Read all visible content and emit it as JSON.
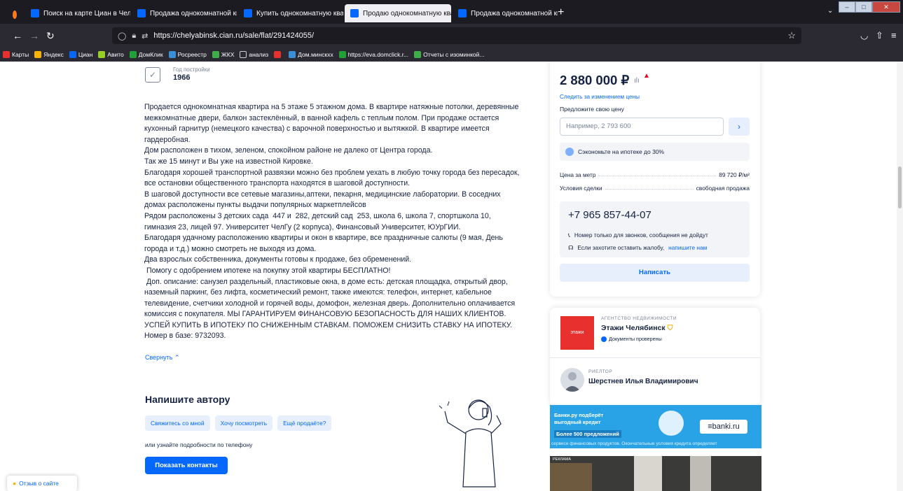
{
  "browser": {
    "tabs": [
      {
        "label": "Поиск на карте Циан в Челяб",
        "active": false
      },
      {
        "label": "Продажа однокомнатной ква",
        "active": false
      },
      {
        "label": "Купить однокомнатную кварт",
        "active": false
      },
      {
        "label": "Продаю однокомнатную квар",
        "active": true
      },
      {
        "label": "Продажа однокомнатной ква",
        "active": false
      }
    ],
    "new_tab": "+",
    "url": "https://chelyabinsk.cian.ru/sale/flat/291424055/",
    "bookmarks": [
      {
        "label": "Карты",
        "color": "#e8312e"
      },
      {
        "label": "Яндекс",
        "color": "#f6b400"
      },
      {
        "label": "Циан",
        "color": "#0468ff"
      },
      {
        "label": "Авито",
        "color": "#97cf26"
      },
      {
        "label": "ДомКлик",
        "color": "#21a038"
      },
      {
        "label": "Росреестр",
        "color": "#3a8fd8"
      },
      {
        "label": "ЖКХ",
        "color": "#3fae49"
      },
      {
        "label": "анализ",
        "color": "#cfcfd8"
      },
      {
        "label": "",
        "color": "#e8312e"
      },
      {
        "label": "Дом.минскхх",
        "color": "#3a8fd8"
      },
      {
        "label": "https://eva.domclick.r...",
        "color": "#21a038"
      },
      {
        "label": "Отчеты с изоминкой...",
        "color": "#3fae49"
      }
    ]
  },
  "listing": {
    "year_label": "Год постройки",
    "year_value": "1966",
    "description": [
      "Продается однокомнатная квартира на 5 этаже 5 этажном дома. В квартире натяжные потолки, деревянные межкомнатные двери, балкон застеклённый, в ванной кафель с теплым полом. При продаже остается кухонный гарнитур (немецкого качества) с варочной поверхностью и вытяжкой. В квартире имеется гардеробная.",
      "Дом расположен в тихом, зеленом, спокойном районе не далеко от Центра города.",
      "Так же 15 минут и Вы уже на известной Кировке.",
      "Благодаря хорошей транспортной развязки можно без проблем уехать в любую точку города без пересадок, все остановки общественного транспорта находятся в шаговой доступности.",
      "В шаговой доступности все сетевые магазины,аптеки, пекарня, медицинские лаборатории. В соседних домах расположены пункты выдачи популярных маркетплейсов",
      "Рядом расположены 3 детских сада  447 и  282, детский сад  253, школа 6, школа 7, спортшкола 10, гимназия 23, лицей 97. Университет ЧелГу (2 корпуса), Финансовый Университет, ЮУрГИИ.",
      "Благодаря удачному расположению квартиры и окон в квартире, все праздничные салюты (9 мая, День города и т.д.) можно смотреть не выходя из дома.",
      "Два взрослых собственника, документы готовы к продаже, без обременений.",
      " Помогу с одобрением ипотеке на покупку этой квартиры БЕСПЛАТНО!",
      " Доп. описание: санузел раздельный, пластиковые окна, в доме есть: детская площадка, открытый двор, наземный паркинг, без лифта, косметический ремонт, также имеются: телефон, интернет, кабельное телевидение, счетчики холодной и горячей воды, домофон, железная дверь. Дополнительно оплачивается комиссия с покупателя. МЫ ГАРАНТИРУЕМ ФИНАНСОВУЮ БЕЗОПАСНОСТЬ ДЛЯ НАШИХ КЛИЕНТОВ. УСПЕЙ КУПИТЬ В ИПОТЕКУ ПО СНИЖЕННЫМ СТАВКАМ. ПОМОЖЕМ СНИЗИТЬ СТАВКУ НА ИПОТЕКУ. Номер в базе: 9732093."
    ],
    "collapse_label": "Свернуть",
    "write_author": {
      "title": "Напишите автору",
      "chips": [
        "Свяжитесь со мной",
        "Хочу посмотреть",
        "Ещё продаёте?"
      ],
      "phone_info": "или узнайте подробности по телефону",
      "show_contacts": "Показать контакты"
    },
    "feedback": "Отзыв о сайте"
  },
  "price_card": {
    "price": "2 880 000 ₽",
    "follow_price": "Следить за изменением цены",
    "offer_label": "Предложите свою цену",
    "offer_placeholder": "Например, 2 793 600",
    "mortgage": "Сэкономьте на ипотеке до 30%",
    "price_per_meter_label": "Цена за метр",
    "price_per_meter_value": "89 720 ₽/м²",
    "deal_label": "Условия сделки",
    "deal_value": "свободная продажа",
    "phone": "+7 965 857-44-07",
    "calls_only": "Номер только для звонков, сообщения не дойдут",
    "complaint_text": "Если захотите оставить жалобу,",
    "complaint_link": "напишите нам",
    "write_button": "Написать"
  },
  "agency": {
    "logo_text": "этажи",
    "type": "АГЕНТСТВО НЕДВИЖИМОСТИ",
    "name": "Этажи Челябинск",
    "verified": "Документы проверены",
    "realtor_type": "РИЕЛТОР",
    "realtor_name": "Шерстнев Илья Владимирович"
  },
  "banki_ad": {
    "line1": "Банки.ру подберёт",
    "line2": "выгодный кредит",
    "line3": "Более 500 предложений",
    "logo": "≡banki.ru",
    "footer": "сервисе финансовых продуктов. Окончательные условия кредита определяет"
  },
  "ad_label": "РЕКЛАМА"
}
